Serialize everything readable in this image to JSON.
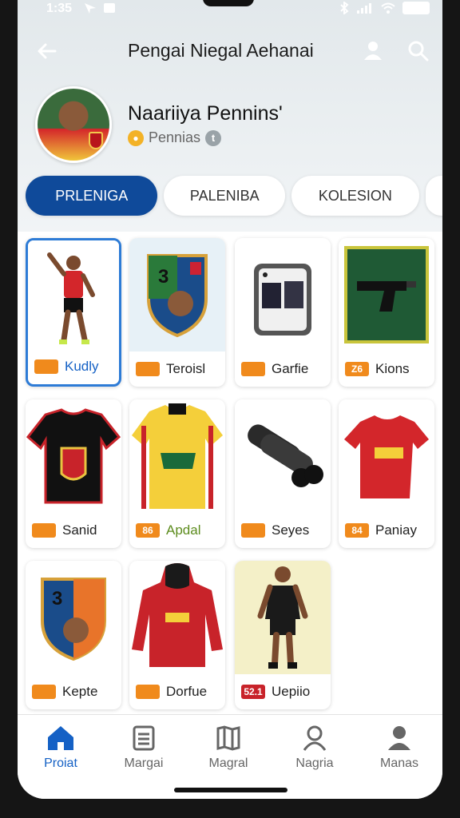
{
  "status_bar": {
    "time": "1:35"
  },
  "header": {
    "title": "Pengai Niegal Aehanai"
  },
  "profile": {
    "name": "Naariiya Pennins'",
    "sub": "Pennias"
  },
  "tabs": [
    {
      "label": "PRLENIGA",
      "active": true
    },
    {
      "label": "PALENIBA",
      "active": false
    },
    {
      "label": "KOLESION",
      "active": false
    }
  ],
  "items": [
    {
      "label": "Kudly",
      "tag": "",
      "icon": "player-figure-icon"
    },
    {
      "label": "Teroisl",
      "tag": "",
      "icon": "shield-crest-icon"
    },
    {
      "label": "Garfie",
      "tag": "",
      "icon": "photo-frame-icon"
    },
    {
      "label": "Kions",
      "tag": "Z6",
      "icon": "gun-jersey-icon"
    },
    {
      "label": "Sanid",
      "tag": "",
      "icon": "jersey-black-icon"
    },
    {
      "label": "Apdal",
      "tag": "86",
      "icon": "jersey-yellow-icon"
    },
    {
      "label": "Seyes",
      "tag": "",
      "icon": "binocular-icon"
    },
    {
      "label": "Paniay",
      "tag": "84",
      "icon": "jersey-red-icon"
    },
    {
      "label": "Kepte",
      "tag": "",
      "icon": "shield-crest-icon"
    },
    {
      "label": "Dorfue",
      "tag": "",
      "icon": "hoodie-icon"
    },
    {
      "label": "Uepiio",
      "tag": "52.1",
      "icon": "player-figure-icon"
    }
  ],
  "bottom_nav": [
    {
      "label": "Proiat",
      "icon": "home-icon",
      "active": true
    },
    {
      "label": "Margai",
      "icon": "list-icon",
      "active": false
    },
    {
      "label": "Magral",
      "icon": "map-icon",
      "active": false
    },
    {
      "label": "Nagria",
      "icon": "user-icon",
      "active": false
    },
    {
      "label": "Manas",
      "icon": "person-icon",
      "active": false
    }
  ],
  "colors": {
    "accent": "#0f4a9a",
    "active_nav": "#1561c5",
    "tag": "#f08a1c"
  }
}
